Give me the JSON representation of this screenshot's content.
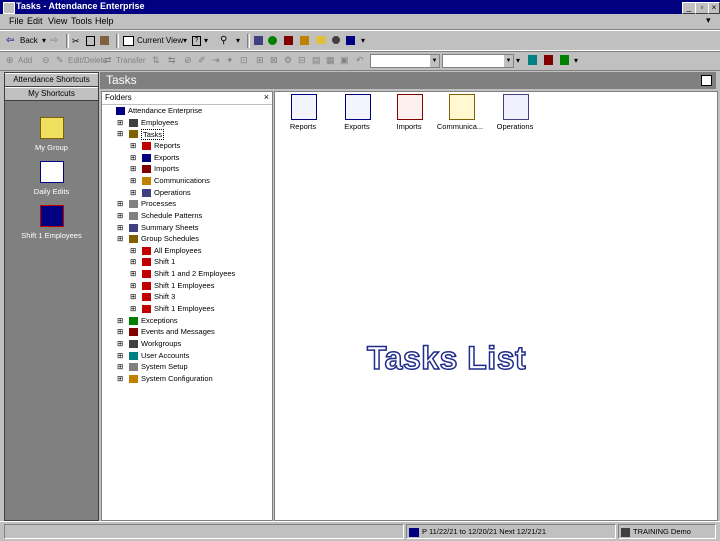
{
  "window": {
    "title": "Tasks - Attendance Enterprise"
  },
  "menu": [
    "File",
    "Edit",
    "View",
    "Tools",
    "Help"
  ],
  "toolbar1": {
    "back": "Back",
    "current_view": "Current View"
  },
  "toolbar2": {
    "add": "Add",
    "edit": "Edit/Delete",
    "transfer": "Transfer"
  },
  "shortcuts": {
    "top_button": "Attendance Shortcuts",
    "group_button": "My Shortcuts",
    "items": [
      {
        "label": "My Group",
        "icon": "folder-icon"
      },
      {
        "label": "Daily Edits",
        "icon": "daily-edits-icon"
      },
      {
        "label": "Shift 1 Employees",
        "icon": "employees-icon"
      }
    ]
  },
  "tasks_header": "Tasks",
  "folders": {
    "header": "Folders",
    "tree": [
      "Attendance Enterprise",
      "Employees",
      "Tasks",
      "Reports",
      "Exports",
      "Imports",
      "Communications",
      "Operations",
      "Processes",
      "Schedule Patterns",
      "Summary Sheets",
      "Group Schedules",
      "All Employees",
      "Shift 1",
      "Shift 1 and 2 Employees",
      "Shift 1 Employees",
      "Shift 3",
      "Shift 1 Employees",
      "Exceptions",
      "Events and Messages",
      "Workgroups",
      "User Accounts",
      "System Setup",
      "System Configuration"
    ]
  },
  "content_icons": [
    {
      "label": "Reports",
      "icon": "reports-icon"
    },
    {
      "label": "Exports",
      "icon": "exports-icon"
    },
    {
      "label": "Imports",
      "icon": "imports-icon"
    },
    {
      "label": "Communica...",
      "icon": "communications-icon"
    },
    {
      "label": "Operations",
      "icon": "operations-icon"
    }
  ],
  "overlay_label": "Tasks List",
  "status": {
    "period": "P 11/22/21 to 12/20/21 Next 12/21/21",
    "user": "TRAINING Demo"
  },
  "colors": {
    "titlebar": "#000080",
    "face": "#c0c0c0",
    "shortcut_bg": "#808080",
    "overlay_text": "#1f2c8a"
  }
}
